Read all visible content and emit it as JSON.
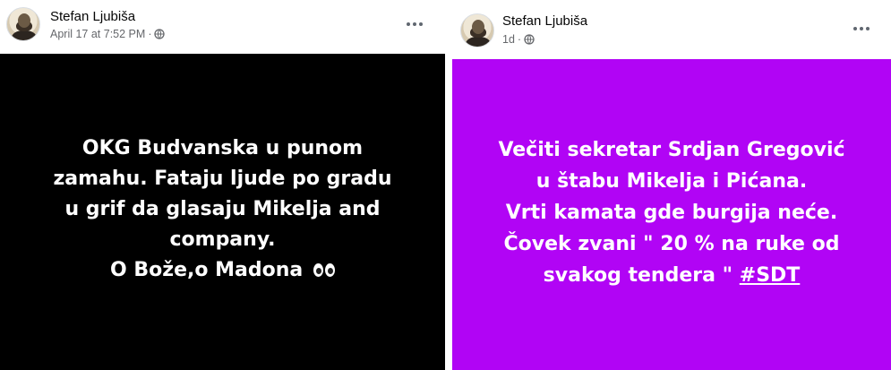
{
  "post_left": {
    "author": "Stefan Ljubiša",
    "timestamp": "April 17 at 7:52 PM",
    "separator": "·",
    "privacy_icon": "globe-icon",
    "more_icon": "more-options-icon",
    "background_color": "#000000",
    "text_lines": [
      "OKG Budvanska u punom",
      "zamahu. Fataju ljude po gradu",
      "u grif da glasaju Mikelja and",
      "company.",
      "O Bože,o Madona"
    ],
    "emoji": "eyes-emoji"
  },
  "post_right": {
    "author": "Stefan Ljubiša",
    "timestamp": "1d",
    "separator": "·",
    "privacy_icon": "globe-icon",
    "more_icon": "more-options-icon",
    "background_color": "#b104f5",
    "text_lines": [
      "Večiti sekretar Srdjan Gregović",
      "u štabu Mikelja i Pićana.",
      "Vrti kamata gde burgija neće.",
      "Čovek zvani \" 20 % na ruke od",
      "svakog tendera \""
    ],
    "hashtag": "#SDT"
  }
}
